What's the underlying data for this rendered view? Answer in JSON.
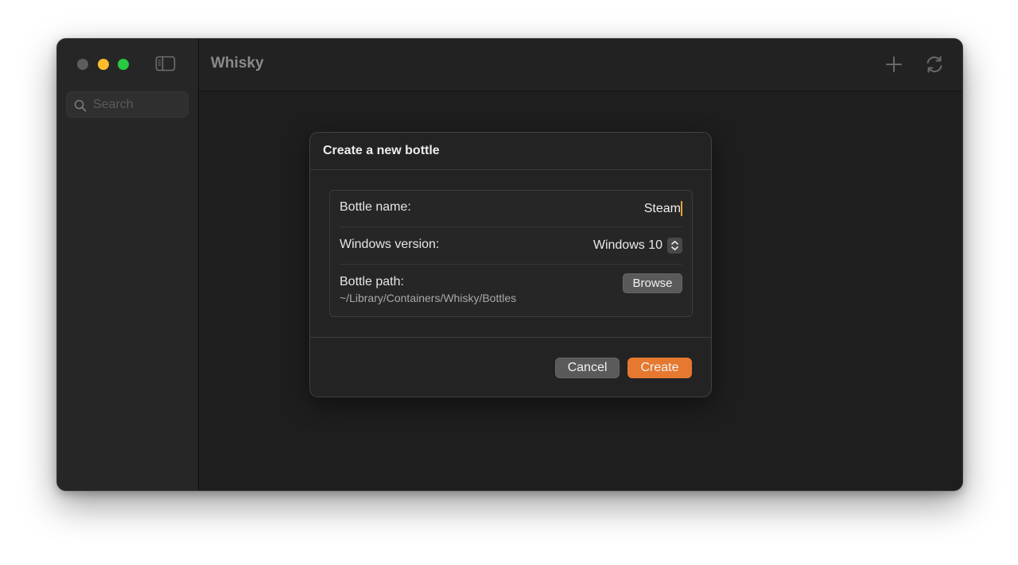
{
  "window": {
    "title": "Whisky"
  },
  "sidebar": {
    "search_placeholder": "Search"
  },
  "toolbar": {
    "add_icon": "plus-icon",
    "refresh_icon": "refresh-icon"
  },
  "dialog": {
    "title": "Create a new bottle",
    "bottle_name_label": "Bottle name:",
    "bottle_name_value": "Steam",
    "windows_version_label": "Windows version:",
    "windows_version_value": "Windows 10",
    "bottle_path_label": "Bottle path:",
    "bottle_path_value": "~/Library/Containers/Whisky/Bottles",
    "browse_label": "Browse",
    "cancel_label": "Cancel",
    "create_label": "Create"
  },
  "colors": {
    "accent": "#e6782f",
    "traffic_close": "#5d5d5f",
    "traffic_minimize": "#febc2e",
    "traffic_maximize": "#28c840"
  }
}
